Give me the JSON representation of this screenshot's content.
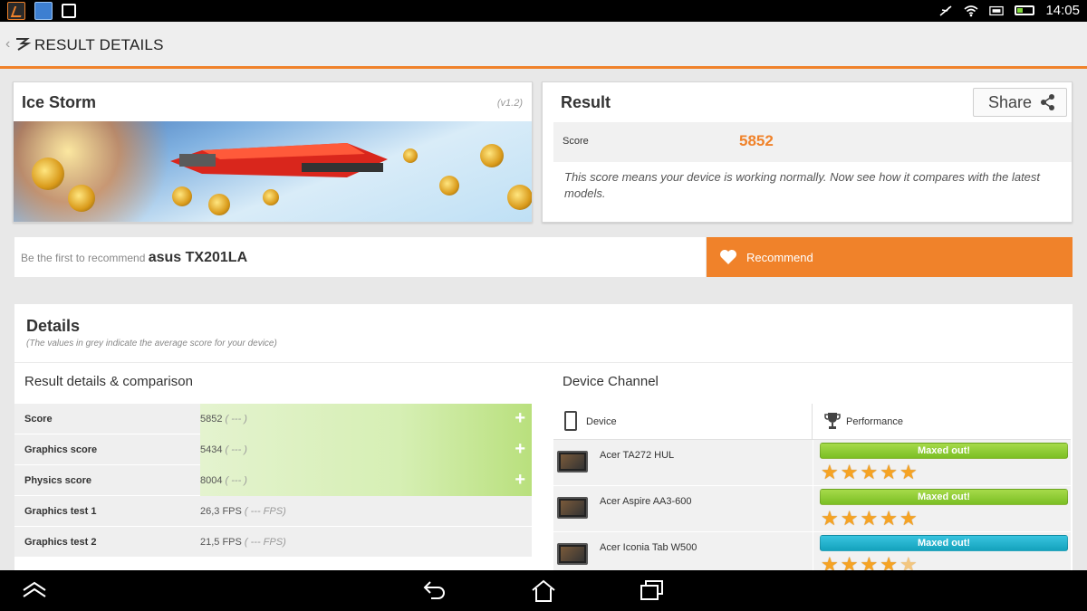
{
  "status_bar": {
    "time": "14:05"
  },
  "header": {
    "title": "RESULT DETAILS"
  },
  "benchmark": {
    "name": "Ice Storm",
    "version": "(v1.2)"
  },
  "result": {
    "title": "Result",
    "share_label": "Share",
    "score_label": "Score",
    "score_value": "5852",
    "note": "This score means your device is working normally. Now see how it compares with the latest models."
  },
  "recommend": {
    "prompt": "Be the first to recommend",
    "device": "asus TX201LA",
    "button_label": "Recommend"
  },
  "details": {
    "title": "Details",
    "subtitle": "(The values in grey indicate the average score for your device)",
    "comparison_title": "Result details & comparison",
    "rows": [
      {
        "label": "Score",
        "value": "5852",
        "average": "( --- )"
      },
      {
        "label": "Graphics score",
        "value": "5434",
        "average": "( --- )"
      },
      {
        "label": "Physics score",
        "value": "8004",
        "average": "( --- )"
      },
      {
        "label": "Graphics test 1",
        "value": "26,3 FPS",
        "average": "( --- FPS)"
      },
      {
        "label": "Graphics test 2",
        "value": "21,5 FPS",
        "average": "( --- FPS)"
      }
    ],
    "channel_title": "Device Channel",
    "channel_col_device": "Device",
    "channel_col_performance": "Performance",
    "devices": [
      {
        "name": "Acer TA272 HUL",
        "badge": "Maxed out!",
        "badge_color": "#8cc63f",
        "stars": 5
      },
      {
        "name": "Acer Aspire AA3-600",
        "badge": "Maxed out!",
        "badge_color": "#8cc63f",
        "stars": 5
      },
      {
        "name": "Acer Iconia Tab W500",
        "badge": "Maxed out!",
        "badge_color": "#1aaec9",
        "stars": 4.5
      }
    ]
  },
  "colors": {
    "accent": "#f0822a"
  }
}
